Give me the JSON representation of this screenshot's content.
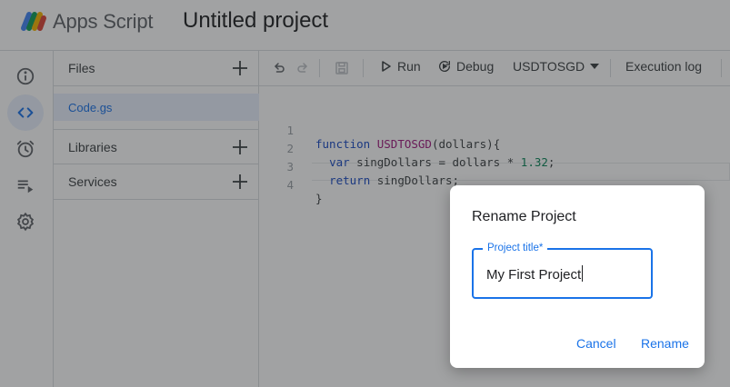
{
  "header": {
    "app_name": "Apps Script",
    "project_title": "Untitled project"
  },
  "rail": {
    "items": [
      {
        "name": "overview",
        "icon": "info-icon"
      },
      {
        "name": "editor",
        "icon": "code-icon",
        "active": true
      },
      {
        "name": "triggers",
        "icon": "alarm-icon"
      },
      {
        "name": "executions",
        "icon": "playlist-play-icon"
      },
      {
        "name": "settings",
        "icon": "gear-icon"
      }
    ]
  },
  "files_panel": {
    "files_label": "Files",
    "file_name": "Code.gs",
    "libraries_label": "Libraries",
    "services_label": "Services"
  },
  "toolbar": {
    "run_label": "Run",
    "debug_label": "Debug",
    "function_select": "USDTOSGD",
    "execution_log_label": "Execution log"
  },
  "editor": {
    "line_numbers": [
      "1",
      "2",
      "3",
      "4"
    ],
    "lines": [
      [
        "function",
        " ",
        "USDTOSGD",
        "(dollars){"
      ],
      [
        "  ",
        "var",
        " singDollars = dollars * ",
        "1.32",
        ";"
      ],
      [
        "  ",
        "return",
        " singDollars;"
      ],
      [
        "}"
      ]
    ]
  },
  "dialog": {
    "title": "Rename Project",
    "field_label": "Project title*",
    "field_value": "My First Project",
    "cancel_label": "Cancel",
    "rename_label": "Rename"
  },
  "colors": {
    "accent": "#1a73e8",
    "active_bg": "#e8f0fe",
    "keyword": "#1a4bc4",
    "function_name": "#a0197f",
    "number": "#098658"
  }
}
